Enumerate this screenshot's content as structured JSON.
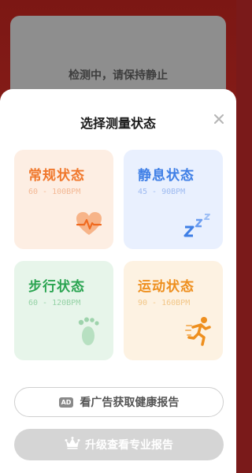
{
  "background": {
    "status_text": "检测中，请保持静止"
  },
  "sheet": {
    "title": "选择测量状态",
    "close_icon": "close-icon",
    "cards": [
      {
        "name": "常规状态",
        "range": "60 - 100BPM",
        "icon": "heart-pulse-icon",
        "color": "#f0772b"
      },
      {
        "name": "静息状态",
        "range": "45 - 90BPM",
        "icon": "sleep-zzz-icon",
        "color": "#3f7fe6"
      },
      {
        "name": "步行状态",
        "range": "60 - 120BPM",
        "icon": "footprint-icon",
        "color": "#2aa451"
      },
      {
        "name": "运动状态",
        "range": "90 - 160BPM",
        "icon": "running-person-icon",
        "color": "#ee8f1e"
      }
    ],
    "ad_button": {
      "badge": "AD",
      "label": "看广告获取健康报告"
    },
    "pro_button": {
      "label": "升级查看专业报告",
      "icon": "crown-icon"
    }
  }
}
